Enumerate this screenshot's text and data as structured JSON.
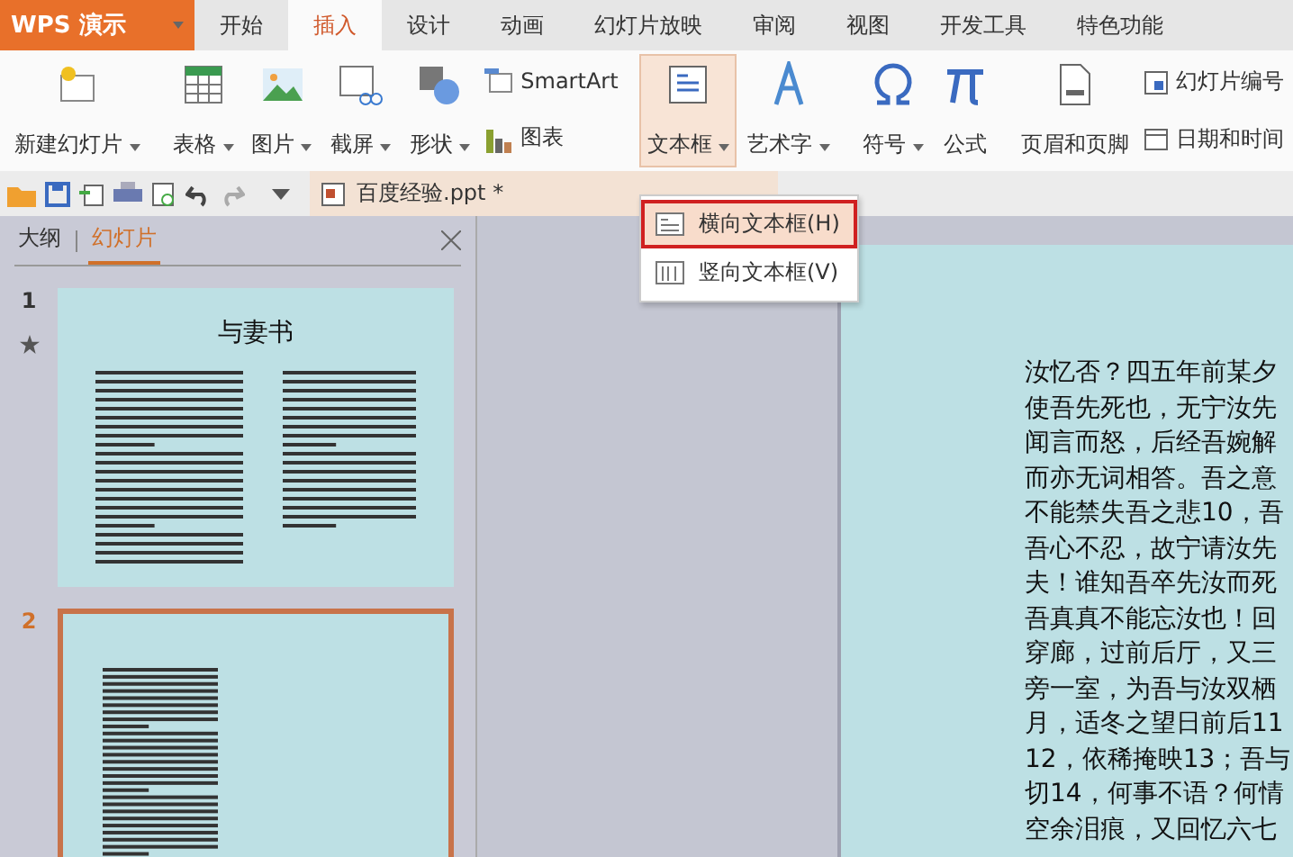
{
  "app_menu": {
    "label": "WPS 演示"
  },
  "tabs": [
    {
      "label": "开始",
      "selected": false
    },
    {
      "label": "插入",
      "selected": true
    },
    {
      "label": "设计",
      "selected": false
    },
    {
      "label": "动画",
      "selected": false
    },
    {
      "label": "幻灯片放映",
      "selected": false
    },
    {
      "label": "审阅",
      "selected": false
    },
    {
      "label": "视图",
      "selected": false
    },
    {
      "label": "开发工具",
      "selected": false
    },
    {
      "label": "特色功能",
      "selected": false
    }
  ],
  "ribbon": {
    "new_slide": "新建幻灯片",
    "table": "表格",
    "picture": "图片",
    "screenshot": "截屏",
    "shape": "形状",
    "smartart": "SmartArt",
    "chart": "图表",
    "textbox": "文本框",
    "wordart": "艺术字",
    "symbol": "符号",
    "formula": "公式",
    "header_footer": "页眉和页脚",
    "slide_number": "幻灯片编号",
    "date_time": "日期和时间"
  },
  "textbox_menu": [
    {
      "label": "横向文本框(H)",
      "selected": true
    },
    {
      "label": "竖向文本框(V)",
      "selected": false
    }
  ],
  "document_tab": {
    "label": "百度经验.ppt *"
  },
  "panel": {
    "tabs": [
      {
        "label": "大纲",
        "selected": false
      },
      {
        "label": "幻灯片",
        "selected": true
      }
    ],
    "slides": [
      {
        "number": "1",
        "title": "与妻书",
        "selected": false,
        "starred": true,
        "kind": "two-column"
      },
      {
        "number": "2",
        "selected": true,
        "starred": false,
        "kind": "one-column"
      }
    ]
  },
  "slide_text": [
    "汝忆否？四五年前某夕",
    "使吾先死也，无宁汝先",
    "闻言而怒，后经吾婉解",
    "而亦无词相答。吾之意",
    "不能禁失吾之悲10，吾",
    "吾心不忍，故宁请汝先",
    "夫！谁知吾卒先汝而死",
    "吾真真不能忘汝也！回",
    "穿廊，过前后厅，又三",
    "旁一室，为吾与汝双栖",
    "月，适冬之望日前后11",
    "12，依稀掩映13；吾与",
    "切14，何事不语？何情",
    "空余泪痕，又回忆六七"
  ]
}
